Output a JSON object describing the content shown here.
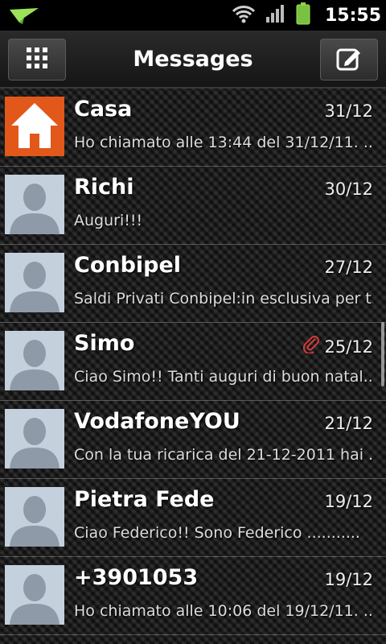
{
  "status_bar": {
    "time": "15:55",
    "icons": [
      "notification-arrow-icon",
      "wifi-icon",
      "signal-icon",
      "battery-icon"
    ],
    "battery_color": "#7ac142"
  },
  "header": {
    "title": "Messages",
    "left_button_icon": "grid-icon",
    "right_button_icon": "compose-icon"
  },
  "messages": [
    {
      "name": "Casa",
      "date": "31/12",
      "preview": "Ho chiamato alle 13:44 del 31/12/11. ...",
      "avatar": "home-icon",
      "attachment": false
    },
    {
      "name": "Richi",
      "date": "30/12",
      "preview": "Auguri!!!",
      "avatar": "contact-placeholder-icon",
      "attachment": false
    },
    {
      "name": "Conbipel",
      "date": "27/12",
      "preview": "Saldi Privati Conbipel:in esclusiva per t...",
      "avatar": "contact-placeholder-icon",
      "attachment": false
    },
    {
      "name": "Simo",
      "date": "25/12",
      "preview": "Ciao Simo!! Tanti auguri di buon natal...",
      "avatar": "contact-placeholder-icon",
      "attachment": true
    },
    {
      "name": "VodafoneYOU",
      "date": "21/12",
      "preview": "Con la tua ricarica del 21-12-2011 hai ...",
      "avatar": "contact-placeholder-icon",
      "attachment": false
    },
    {
      "name": "Pietra Fede",
      "date": "19/12",
      "preview": "Ciao Federico!! Sono Federico ...........",
      "avatar": "contact-placeholder-icon",
      "attachment": false
    },
    {
      "name": "+3901053",
      "date": "19/12",
      "preview": "Ho chiamato alle 10:06 del 19/12/11. ...",
      "avatar": "contact-placeholder-icon",
      "attachment": false
    }
  ],
  "colors": {
    "home_tile": "#e2571a",
    "avatar_bg": "#c5d0dd",
    "attachment": "#d83a3a"
  }
}
